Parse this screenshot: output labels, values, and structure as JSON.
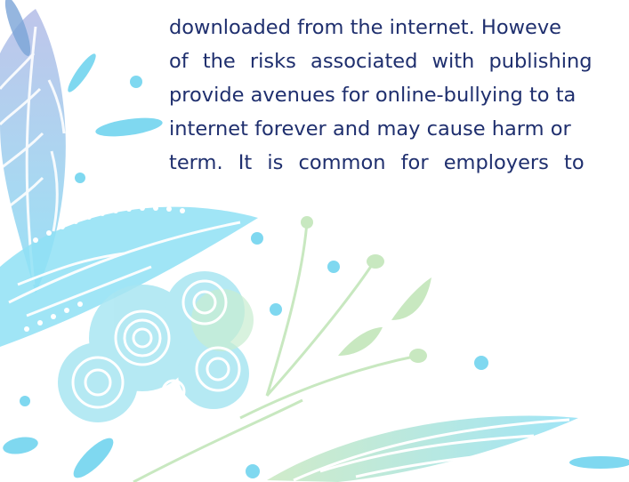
{
  "document": {
    "lines": [
      "downloaded from the internet. Howeve",
      "of the risks associated with publishing",
      "provide avenues for online-bullying to ta",
      "internet forever and may cause harm or",
      "term. It is common for employers to"
    ]
  },
  "colors": {
    "text": "#1f2f6e",
    "art_blue": "#8fe0f5",
    "art_cyan": "#7fd8f0",
    "art_green": "#bfe3b8",
    "art_lavender": "#b8bfe8"
  }
}
